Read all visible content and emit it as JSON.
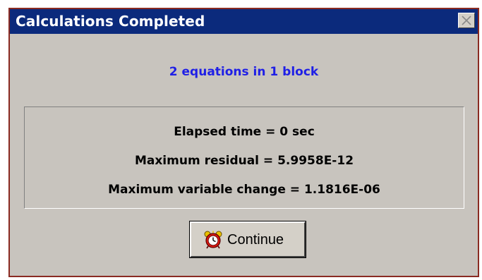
{
  "window": {
    "title": "Calculations Completed",
    "close_icon": "close-icon"
  },
  "summary": {
    "text": "2 equations in 1 block",
    "color": "#1f1fe6"
  },
  "results": {
    "elapsed_time": "Elapsed time = 0 sec",
    "max_residual": "Maximum residual = 5.9958E-12",
    "max_variable_change": "Maximum variable change = 1.1816E-06"
  },
  "buttons": {
    "continue_label": "Continue",
    "continue_icon": "alarm-clock-icon"
  },
  "colors": {
    "titlebar": "#0b2a7c",
    "dialog_background": "#c8c4be",
    "border": "#8a2b22"
  }
}
